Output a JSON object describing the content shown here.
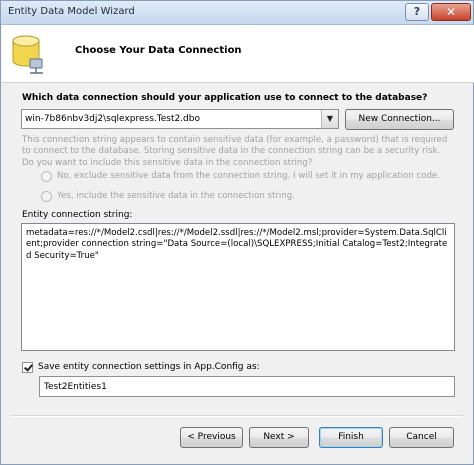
{
  "window": {
    "title": "Entity Data Model Wizard",
    "help_label": "?",
    "close_label": "✕"
  },
  "header": {
    "title": "Choose Your Data Connection",
    "icon": "database-icon"
  },
  "connection": {
    "question": "Which data connection should your application use to connect to the database?",
    "selected": "win-7b86nbv3dj2\\sqlexpress.Test2.dbo",
    "new_connection_label": "New Connection..."
  },
  "sensitive": {
    "notice": "This connection string appears to contain sensitive data (for example, a password) that is required to connect to the database. Storing sensitive data in the connection string can be a security risk. Do you want to include this sensitive data in the connection string?",
    "option_no": "No, exclude sensitive data from the connection string. I will set it in my application code.",
    "option_yes": "Yes, include the sensitive data in the connection string."
  },
  "entity_connection": {
    "label": "Entity connection string:",
    "value": "metadata=res://*/Model2.csdl|res://*/Model2.ssdl|res://*/Model2.msl;provider=System.Data.SqlClient;provider connection string=\"Data Source=(local)\\SQLEXPRESS;Initial Catalog=Test2;Integrated Security=True\""
  },
  "save": {
    "checked": true,
    "label": "Save entity connection settings in App.Config as:",
    "name_value": "Test2Entities1"
  },
  "footer": {
    "previous_label": "< Previous",
    "next_label": "Next >",
    "finish_label": "Finish",
    "cancel_label": "Cancel"
  }
}
